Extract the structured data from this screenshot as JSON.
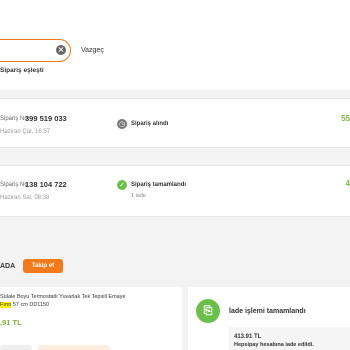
{
  "search": {
    "value": ""
  },
  "header": {
    "cancel_label": "Vazgeç",
    "match_label": "Sipariş eşleşti"
  },
  "orders": [
    {
      "no_label": "Sipariş No",
      "no": "399 519 033",
      "date": "Haziran Çar, 16:57",
      "status": "Sipariş alındı",
      "status_sub": "",
      "amount": "55"
    },
    {
      "no_label": "Sipariş No",
      "no": "138 104 722",
      "date": "Haziran Sal, 08:38",
      "status": "Sipariş tamamlandı",
      "status_sub": "1 iade",
      "amount": "4"
    }
  ],
  "seller": {
    "name": "ADA",
    "follow_label": "Takip et"
  },
  "product": {
    "name_line1": "Sülale Boyu Termostatlı Yuvarlak Tek Tepsili Emaye",
    "name_hl": "Fırın",
    "name_line2_after": " 57 cm DD1150",
    "price": ",91 TL"
  },
  "refund": {
    "title": "İade işlemi tamamlandı",
    "amount": "413.91 TL",
    "note": "Hepsipay hesabına iade edildi."
  },
  "colors": {
    "accent": "#f27a1a",
    "success": "#6dbf4b",
    "amount": "#7cb342"
  }
}
